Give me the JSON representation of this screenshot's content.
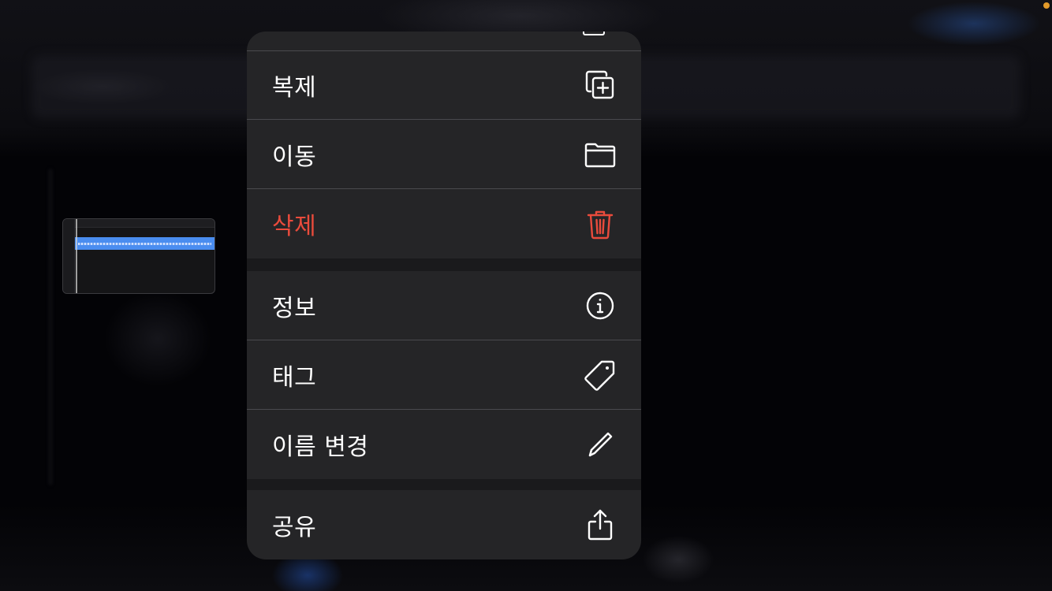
{
  "menu": {
    "items": [
      {
        "label": "복제",
        "icon": "duplicate-icon",
        "style": "default"
      },
      {
        "label": "이동",
        "icon": "folder-icon",
        "style": "default"
      },
      {
        "label": "삭제",
        "icon": "trash-icon",
        "style": "destructive"
      },
      {
        "label": "정보",
        "icon": "info-icon",
        "style": "default"
      },
      {
        "label": "태그",
        "icon": "tag-icon",
        "style": "default"
      },
      {
        "label": "이름 변경",
        "icon": "pencil-icon",
        "style": "default"
      },
      {
        "label": "공유",
        "icon": "share-icon",
        "style": "default"
      }
    ]
  },
  "colors": {
    "menu_background": "#252527",
    "destructive": "#ea4b3c",
    "text": "#ffffff",
    "status_dot": "#e29a2a",
    "track_blue": "#4a8df0"
  }
}
